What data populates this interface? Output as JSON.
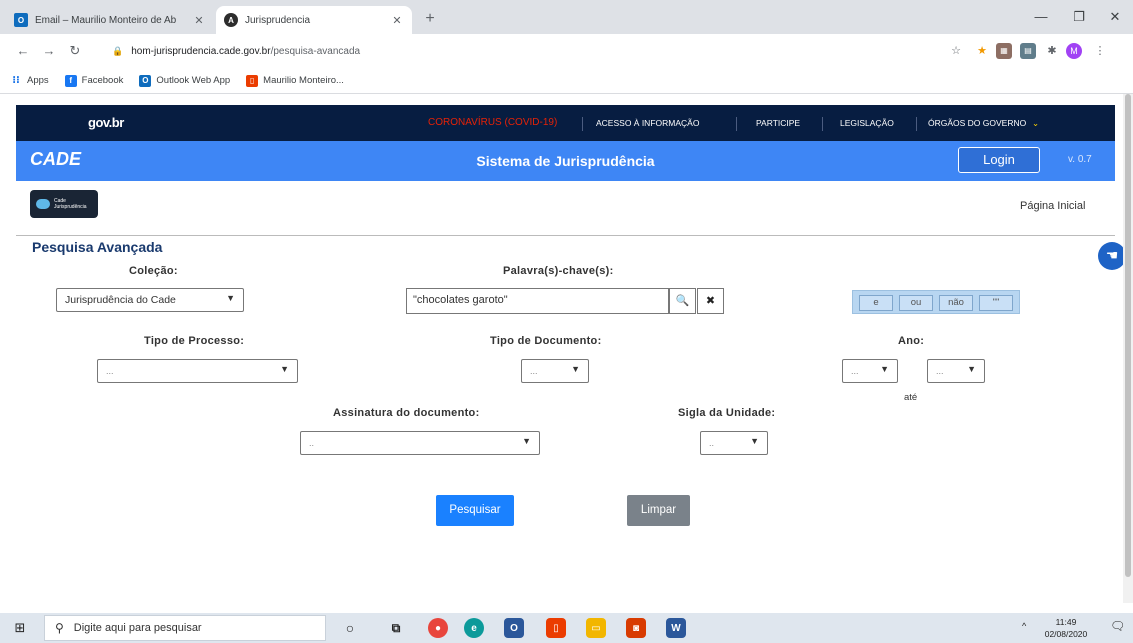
{
  "browser": {
    "tabs": [
      {
        "title": "Email – Maurilio Monteiro de Ab",
        "active": false,
        "icon": "outlook-icon"
      },
      {
        "title": "Jurisprudencia",
        "active": true,
        "icon": "angular-icon"
      }
    ],
    "url_host": "hom-jurisprudencia.cade.gov.br",
    "url_path": "/pesquisa-avancada",
    "profile_initial": "M",
    "bookmarks": [
      {
        "label": "Apps",
        "icon": "apps-grid-icon"
      },
      {
        "label": "Facebook",
        "icon": "facebook-icon"
      },
      {
        "label": "Outlook Web App",
        "icon": "outlook-icon"
      },
      {
        "label": "Maurilio Monteiro...",
        "icon": "office-icon"
      }
    ]
  },
  "gov_header": {
    "logo": "gov.br",
    "links": [
      "CORONAVÍRUS (COVID-19)",
      "ACESSO À INFORMAÇÃO",
      "PARTICIPE",
      "LEGISLAÇÃO",
      "ÓRGÃOS DO GOVERNO"
    ]
  },
  "app_header": {
    "logo": "CADE",
    "title": "Sistema de Jurisprudência",
    "login_label": "Login",
    "version": "v. 0.7"
  },
  "brand_badge": {
    "line1": "Cade",
    "line2": "Jurisprudência"
  },
  "home_link": "Página Inicial",
  "form": {
    "heading": "Pesquisa Avançada",
    "colecao": {
      "label": "Coleção:",
      "value": "Jurisprudência do Cade"
    },
    "keywords": {
      "label": "Palavra(s)-chave(s):",
      "value": "\"chocolates garoto\""
    },
    "operators": [
      "e",
      "ou",
      "não",
      "\"\""
    ],
    "tipo_processo": {
      "label": "Tipo de Processo:",
      "value": "..."
    },
    "tipo_documento": {
      "label": "Tipo de Documento:",
      "value": "..."
    },
    "ano": {
      "label": "Ano:",
      "from": "...",
      "separator": "até",
      "to": "..."
    },
    "assinatura": {
      "label": "Assinatura do documento:",
      "value": ".."
    },
    "sigla": {
      "label": "Sigla da Unidade:",
      "value": ".."
    },
    "search_label": "Pesquisar",
    "clear_label": "Limpar"
  },
  "taskbar": {
    "search_placeholder": "Digite aqui para pesquisar",
    "time": "11:49",
    "date": "02/08/2020"
  },
  "colors": {
    "gov_bar": "#071d41",
    "cade_bar": "#3e86f5",
    "primary_button": "#1a81ff",
    "secondary_button": "#7a828a",
    "covid_link": "#e52207"
  }
}
